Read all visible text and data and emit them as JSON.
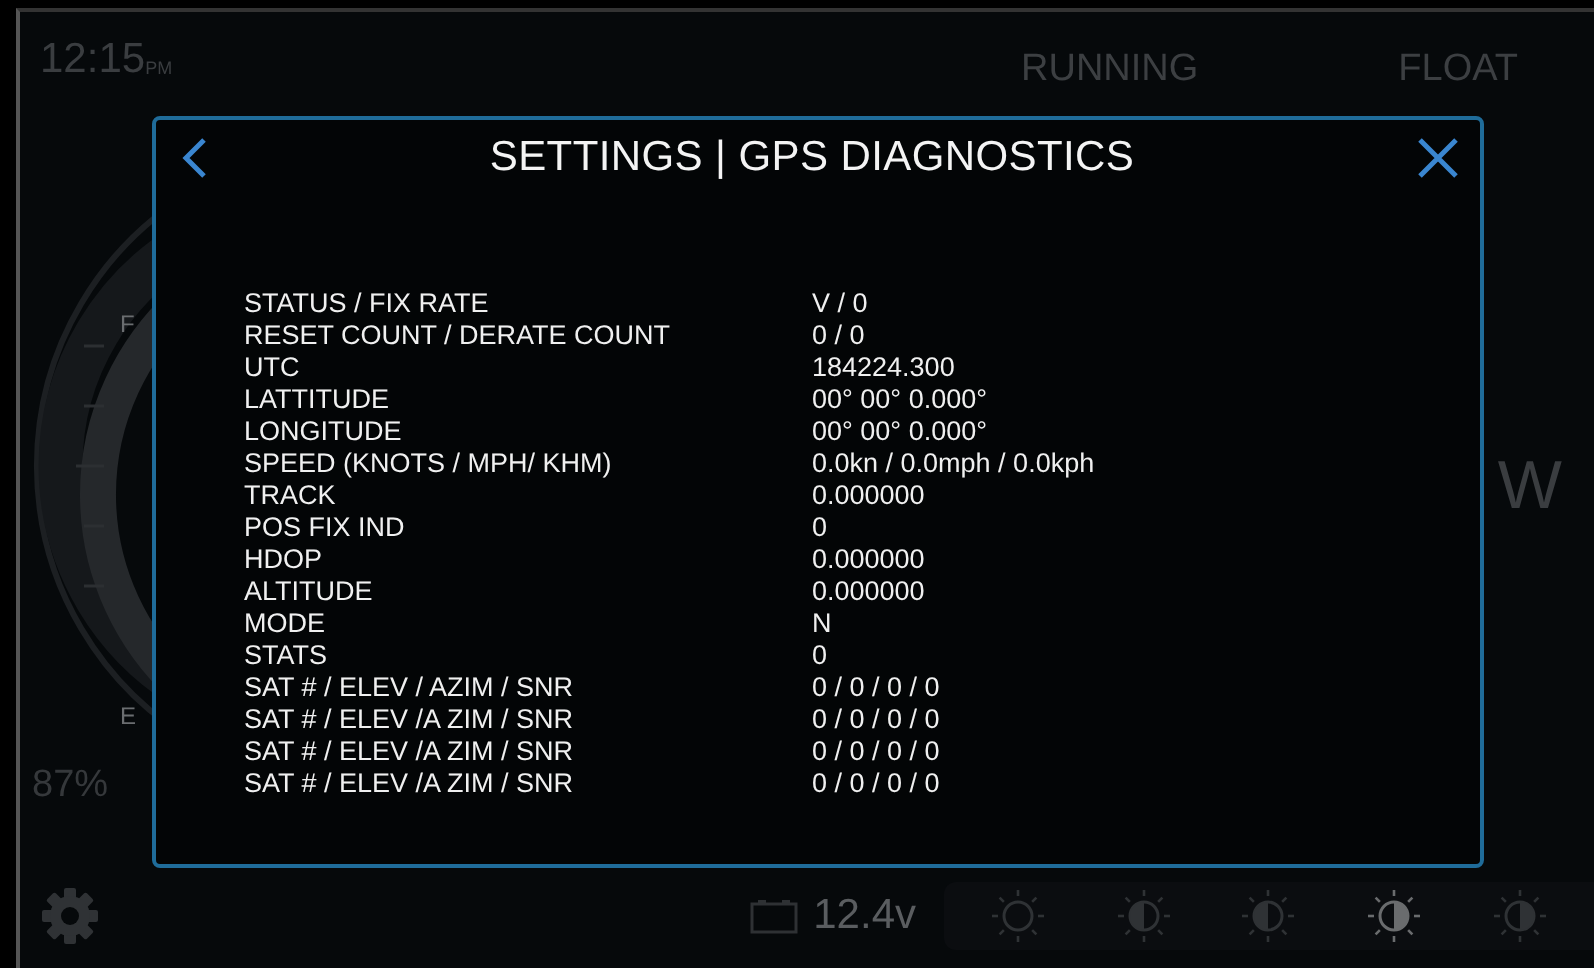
{
  "top_bar": {
    "time": "12:15",
    "meridiem": "PM",
    "statuses": [
      "RUNNING",
      "FLOAT"
    ]
  },
  "fuel_gauge": {
    "full_label": "F",
    "empty_label": "E",
    "reading": "87%",
    "level": 0.87
  },
  "compass": {
    "heading": "W"
  },
  "bottom_bar": {
    "voltage": "12.4v",
    "brightness": [
      {
        "selected": false
      },
      {
        "selected": false
      },
      {
        "selected": false
      },
      {
        "selected": true
      },
      {
        "selected": false
      }
    ]
  },
  "dialog": {
    "title": "SETTINGS | GPS DIAGNOSTICS",
    "rows": [
      {
        "label": "STATUS / FIX RATE",
        "value": "V / 0"
      },
      {
        "label": "RESET COUNT / DERATE COUNT",
        "value": "0 / 0"
      },
      {
        "label": "UTC",
        "value": "184224.300"
      },
      {
        "label": "LATTITUDE",
        "value": "00° 00° 0.000°"
      },
      {
        "label": "LONGITUDE",
        "value": "00° 00° 0.000°"
      },
      {
        "label": "SPEED (KNOTS / MPH/ KHM)",
        "value": "0.0kn / 0.0mph / 0.0kph"
      },
      {
        "label": "TRACK",
        "value": "0.000000"
      },
      {
        "label": "POS FIX IND",
        "value": "0"
      },
      {
        "label": "HDOP",
        "value": "0.000000"
      },
      {
        "label": "ALTITUDE",
        "value": "0.000000"
      },
      {
        "label": "MODE",
        "value": "N"
      },
      {
        "label": "STATS",
        "value": "0"
      },
      {
        "label": "SAT # / ELEV / AZIM / SNR",
        "value": "0 / 0 / 0 / 0"
      },
      {
        "label": "SAT # / ELEV /A ZIM / SNR",
        "value": "0 / 0 / 0 / 0"
      },
      {
        "label": "SAT # / ELEV /A ZIM / SNR",
        "value": "0 / 0 / 0 / 0"
      },
      {
        "label": "SAT # / ELEV /A ZIM / SNR",
        "value": "0 / 0 / 0 / 0"
      }
    ]
  }
}
